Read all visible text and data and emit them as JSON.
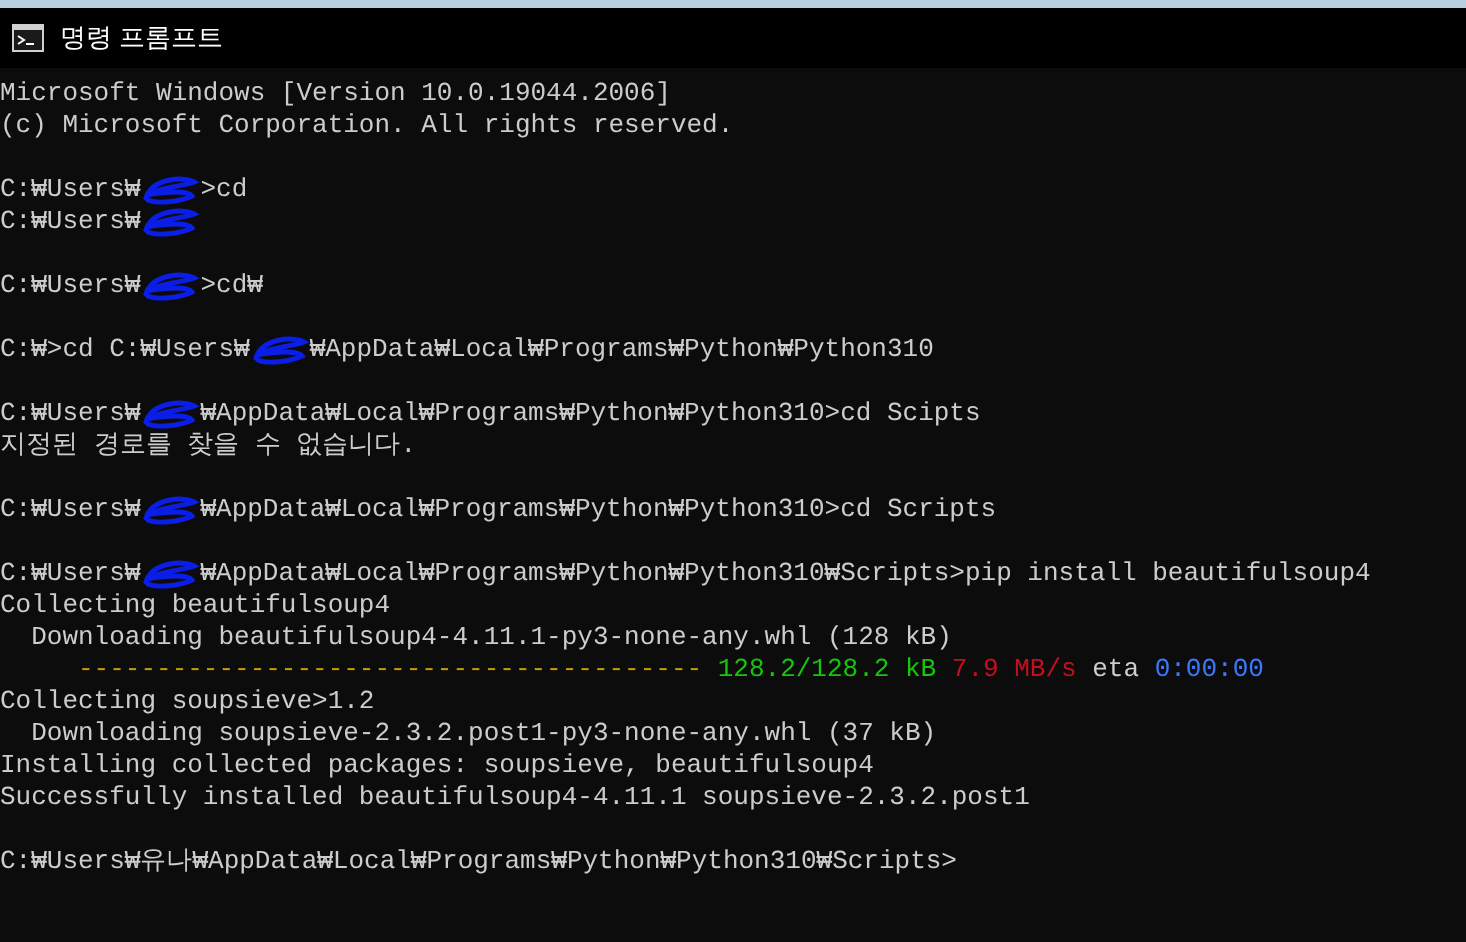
{
  "window": {
    "title": "명령 프롬프트"
  },
  "lines": [
    {
      "kind": "text",
      "segments": [
        {
          "kind": "text",
          "text": "Microsoft Windows [Version 10.0.19044.2006]"
        }
      ]
    },
    {
      "kind": "text",
      "segments": [
        {
          "kind": "text",
          "text": "(c) Microsoft Corporation. All rights reserved."
        }
      ]
    },
    {
      "kind": "blank"
    },
    {
      "kind": "text",
      "segments": [
        {
          "kind": "text",
          "text": "C:₩Users₩"
        },
        {
          "kind": "scribble"
        },
        {
          "kind": "text",
          "text": ">cd"
        }
      ]
    },
    {
      "kind": "text",
      "segments": [
        {
          "kind": "text",
          "text": "C:₩Users₩"
        },
        {
          "kind": "scribble"
        }
      ]
    },
    {
      "kind": "blank"
    },
    {
      "kind": "text",
      "segments": [
        {
          "kind": "text",
          "text": "C:₩Users₩"
        },
        {
          "kind": "scribble"
        },
        {
          "kind": "text",
          "text": ">cd₩"
        }
      ]
    },
    {
      "kind": "blank"
    },
    {
      "kind": "text",
      "segments": [
        {
          "kind": "text",
          "text": "C:₩>cd C:₩Users₩"
        },
        {
          "kind": "scribble"
        },
        {
          "kind": "text",
          "text": "₩AppData₩Local₩Programs₩Python₩Python310"
        }
      ]
    },
    {
      "kind": "blank"
    },
    {
      "kind": "text",
      "segments": [
        {
          "kind": "text",
          "text": "C:₩Users₩"
        },
        {
          "kind": "scribble"
        },
        {
          "kind": "text",
          "text": "₩AppData₩Local₩Programs₩Python₩Python310>cd Scipts"
        }
      ]
    },
    {
      "kind": "text",
      "segments": [
        {
          "kind": "text",
          "text": "지정된 경로를 찾을 수 없습니다."
        }
      ]
    },
    {
      "kind": "blank"
    },
    {
      "kind": "text",
      "segments": [
        {
          "kind": "text",
          "text": "C:₩Users₩"
        },
        {
          "kind": "scribble"
        },
        {
          "kind": "text",
          "text": "₩AppData₩Local₩Programs₩Python₩Python310>cd Scripts"
        }
      ]
    },
    {
      "kind": "blank"
    },
    {
      "kind": "text",
      "segments": [
        {
          "kind": "text",
          "text": "C:₩Users₩"
        },
        {
          "kind": "scribble"
        },
        {
          "kind": "text",
          "text": "₩AppData₩Local₩Programs₩Python₩Python310₩Scripts>pip install beautifulsoup4"
        }
      ]
    },
    {
      "kind": "text",
      "segments": [
        {
          "kind": "text",
          "text": "Collecting beautifulsoup4"
        }
      ]
    },
    {
      "kind": "text",
      "segments": [
        {
          "kind": "text",
          "text": "  Downloading beautifulsoup4-4.11.1-py3-none-any.whl (128 kB)"
        }
      ]
    },
    {
      "kind": "text",
      "segments": [
        {
          "kind": "text",
          "text": "     ----------------------------------------",
          "color": "#c19c00"
        },
        {
          "kind": "text",
          "text": " 128.2/128.2 kB",
          "color": "#16c60c"
        },
        {
          "kind": "text",
          "text": " 7.9 MB/s",
          "color": "#c50f1f"
        },
        {
          "kind": "text",
          "text": " eta "
        },
        {
          "kind": "text",
          "text": "0:00:00",
          "color": "#3b78ff"
        }
      ]
    },
    {
      "kind": "text",
      "segments": [
        {
          "kind": "text",
          "text": "Collecting soupsieve>1.2"
        }
      ]
    },
    {
      "kind": "text",
      "segments": [
        {
          "kind": "text",
          "text": "  Downloading soupsieve-2.3.2.post1-py3-none-any.whl (37 kB)"
        }
      ]
    },
    {
      "kind": "text",
      "segments": [
        {
          "kind": "text",
          "text": "Installing collected packages: soupsieve, beautifulsoup4"
        }
      ]
    },
    {
      "kind": "text",
      "segments": [
        {
          "kind": "text",
          "text": "Successfully installed beautifulsoup4-4.11.1 soupsieve-2.3.2.post1"
        }
      ]
    },
    {
      "kind": "blank"
    },
    {
      "kind": "text",
      "segments": [
        {
          "kind": "text",
          "text": "C:₩Users₩유나₩AppData₩Local₩Programs₩Python₩Python310₩Scripts>"
        }
      ]
    }
  ]
}
